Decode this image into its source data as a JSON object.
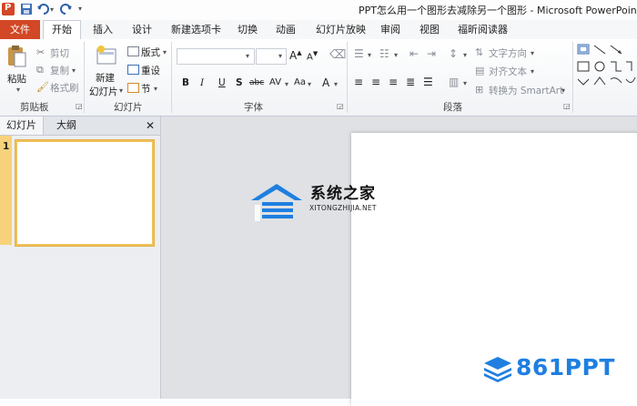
{
  "window": {
    "title": "PPT怎么用一个图形去减除另一个图形 - Microsoft PowerPoint"
  },
  "tabs": {
    "file": "文件",
    "items": [
      "开始",
      "插入",
      "设计",
      "新建选项卡",
      "切换",
      "动画",
      "幻灯片放映",
      "审阅",
      "视图",
      "福昕阅读器"
    ]
  },
  "ribbon": {
    "clipboard": {
      "paste": "粘贴",
      "cut": "剪切",
      "copy": "复制",
      "format_painter": "格式刷",
      "label": "剪贴板"
    },
    "slides": {
      "new_slide_1": "新建",
      "new_slide_2": "幻灯片",
      "layout": "版式",
      "reset": "重设",
      "section": "节",
      "label": "幻灯片"
    },
    "font": {
      "label": "字体",
      "bold": "B",
      "italic": "I",
      "underline": "U",
      "shadow": "S",
      "strike": "abc",
      "spacing": "AV",
      "case": "Aa",
      "color": "A"
    },
    "paragraph": {
      "text_direction": "文字方向",
      "align_text": "对齐文本",
      "convert_smartart": "转换为 SmartArt",
      "label": "段落"
    }
  },
  "slides_pane": {
    "tab_slides": "幻灯片",
    "tab_outline": "大纲",
    "close": "✕",
    "slide_number": "1"
  },
  "watermarks": {
    "xitong_cn": "系统之家",
    "xitong_en": "XITONGZHIJIA.NET",
    "brand": "861PPT"
  },
  "colors": {
    "file_tab": "#d24726",
    "thumb_border": "#f1c056",
    "brand_blue": "#1f7fe0"
  }
}
